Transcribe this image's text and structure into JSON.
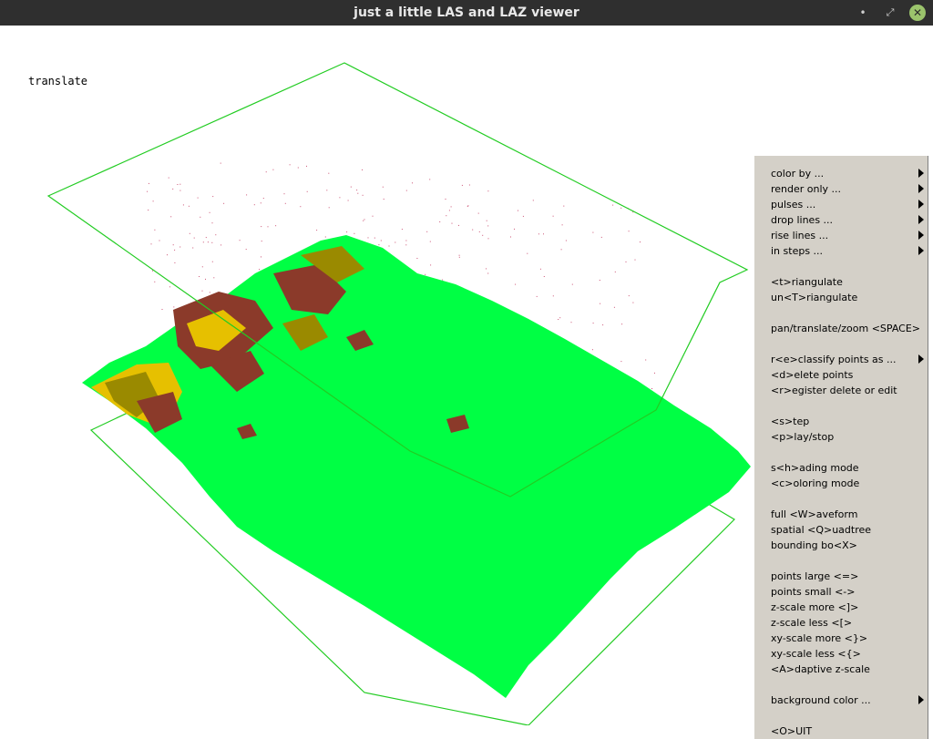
{
  "window": {
    "title": "just a little LAS and LAZ viewer",
    "controls": {
      "minimize": "•",
      "maximize": "⤢",
      "close": "✕"
    }
  },
  "viewer": {
    "mode_label": "translate",
    "colors": {
      "background": "#ffffff",
      "bounding_box": "#22cc22",
      "terrain": "#00ff44",
      "class_brown": "#8b3a2a",
      "class_olive": "#9a8a00",
      "class_yellow": "#e6c000",
      "points": "#cc5577"
    }
  },
  "popup_menu": {
    "items": [
      {
        "label": "color by ...",
        "submenu": true
      },
      {
        "label": "render only ...",
        "submenu": true
      },
      {
        "label": "pulses ...",
        "submenu": true
      },
      {
        "label": "drop lines ...",
        "submenu": true
      },
      {
        "label": "rise lines ...",
        "submenu": true
      },
      {
        "label": "in steps ...",
        "submenu": true
      },
      {
        "label": "<t>riangulate",
        "submenu": false
      },
      {
        "label": "un<T>riangulate",
        "submenu": false
      },
      {
        "label": "pan/translate/zoom <SPACE>",
        "submenu": false
      },
      {
        "label": "r<e>classify points as ...",
        "submenu": true
      },
      {
        "label": "<d>elete points",
        "submenu": false
      },
      {
        "label": "<r>egister delete or edit",
        "submenu": false
      },
      {
        "label": "<s>tep",
        "submenu": false
      },
      {
        "label": "<p>lay/stop",
        "submenu": false
      },
      {
        "label": "s<h>ading mode",
        "submenu": false
      },
      {
        "label": "<c>oloring mode",
        "submenu": false
      },
      {
        "label": "full <W>aveform",
        "submenu": false
      },
      {
        "label": "spatial <Q>uadtree",
        "submenu": false
      },
      {
        "label": "bounding bo<X>",
        "submenu": false
      },
      {
        "label": "points large <=>",
        "submenu": false
      },
      {
        "label": "points small <->",
        "submenu": false
      },
      {
        "label": "z-scale more <]>",
        "submenu": false
      },
      {
        "label": "z-scale less <[>",
        "submenu": false
      },
      {
        "label": "xy-scale more <}>",
        "submenu": false
      },
      {
        "label": "xy-scale less <{>",
        "submenu": false
      },
      {
        "label": "<A>daptive z-scale",
        "submenu": false
      },
      {
        "label": "background color ...",
        "submenu": true
      },
      {
        "label": "<O>UIT",
        "submenu": false
      }
    ]
  }
}
